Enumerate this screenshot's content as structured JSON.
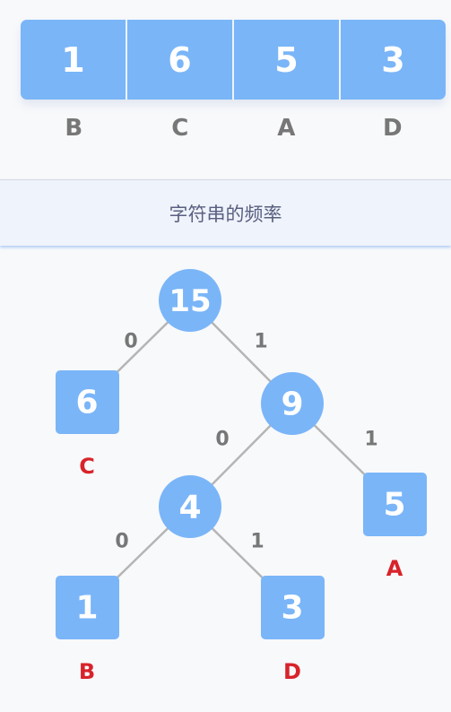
{
  "colors": {
    "node": "#7ab5f8",
    "edge": "#b5b5b5",
    "edge_label": "#777777",
    "leaf_label": "#d8232a",
    "background": "#f8f9fb"
  },
  "frequencies": [
    {
      "char": "B",
      "count": "1"
    },
    {
      "char": "C",
      "count": "6"
    },
    {
      "char": "A",
      "count": "5"
    },
    {
      "char": "D",
      "count": "3"
    }
  ],
  "caption": "字符串的频率",
  "tree": {
    "nodes": [
      {
        "id": "root",
        "value": "15",
        "shape": "circle"
      },
      {
        "id": "n9",
        "value": "9",
        "shape": "circle"
      },
      {
        "id": "n4",
        "value": "4",
        "shape": "circle"
      },
      {
        "id": "C",
        "value": "6",
        "shape": "square",
        "label": "C"
      },
      {
        "id": "A",
        "value": "5",
        "shape": "square",
        "label": "A"
      },
      {
        "id": "B",
        "value": "1",
        "shape": "square",
        "label": "B"
      },
      {
        "id": "D",
        "value": "3",
        "shape": "square",
        "label": "D"
      }
    ],
    "edges": [
      {
        "from": "root",
        "to": "C",
        "bit": "0"
      },
      {
        "from": "root",
        "to": "n9",
        "bit": "1"
      },
      {
        "from": "n9",
        "to": "n4",
        "bit": "0"
      },
      {
        "from": "n9",
        "to": "A",
        "bit": "1"
      },
      {
        "from": "n4",
        "to": "B",
        "bit": "0"
      },
      {
        "from": "n4",
        "to": "D",
        "bit": "1"
      }
    ]
  }
}
